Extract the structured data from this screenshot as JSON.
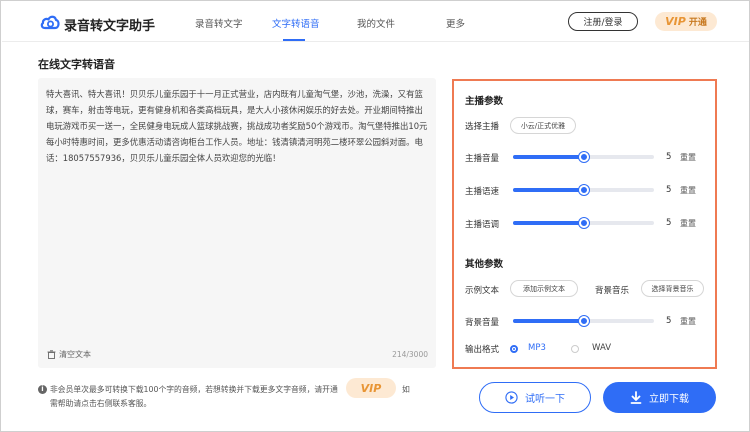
{
  "header": {
    "brand": "录音转文字助手",
    "nav": [
      "录音转文字",
      "文字转语音",
      "我的文件",
      "更多"
    ],
    "login": "注册/登录",
    "vip_mark": "VIP",
    "vip_label": "开通"
  },
  "page": {
    "title": "在线文字转语音"
  },
  "editor": {
    "text": "特大喜讯、特大喜讯！贝贝乐儿童乐园于十一月正式营业，店内既有儿童淘气堡，沙池，洗澡，又有篮球，赛车，射击等电玩，更有健身机和各类高档玩具，是大人小孩休闲娱乐的好去处。开业期间特推出电玩游戏币买一送一，全民健身电玩成人篮球挑战赛，挑战成功者奖励50个游戏币。淘气堡特推出10元每小时特惠时间，更多优惠活动请咨询柜台工作人员。地址：钱清镇清河明苑二楼环翠公园斜对面。电话：18057557936，贝贝乐儿童乐园全体人员欢迎您的光临！",
    "clear_label": "清空文本",
    "char_count": "214/3000"
  },
  "notice": {
    "line1": "非会员单次最多可转换下载100个字的音频，若想转换并下载更多文字音频，请开通",
    "vip": "VIP",
    "suffix": "如",
    "line2": "需帮助请点击右侧联系客服。"
  },
  "panel": {
    "section1": "主播参数",
    "anchor_label": "选择主播",
    "anchor_value": "小云/正式优雅",
    "volume": {
      "label": "主播音量",
      "value": "5",
      "level": 0.5,
      "reset": "重置"
    },
    "speed": {
      "label": "主播语速",
      "value": "5",
      "level": 0.5,
      "reset": "重置"
    },
    "pitch": {
      "label": "主播语调",
      "value": "5",
      "level": 0.5,
      "reset": "重置"
    },
    "section2": "其他参数",
    "sample_label": "示例文本",
    "sample_btn": "添加示例文本",
    "bgm_label": "背景音乐",
    "bgm_btn": "选择背景音乐",
    "bg_volume": {
      "label": "背景音量",
      "value": "5",
      "level": 0.5,
      "reset": "重置"
    },
    "format_label": "输出格式",
    "formats": [
      "MP3",
      "WAV"
    ],
    "selected_format": "MP3"
  },
  "actions": {
    "listen": "试听一下",
    "download": "立即下载"
  },
  "colors": {
    "accent": "#2f6df6",
    "highlight_border": "#ef7a52",
    "vip_bg": "#fde9d3",
    "vip_text": "#e89535"
  }
}
